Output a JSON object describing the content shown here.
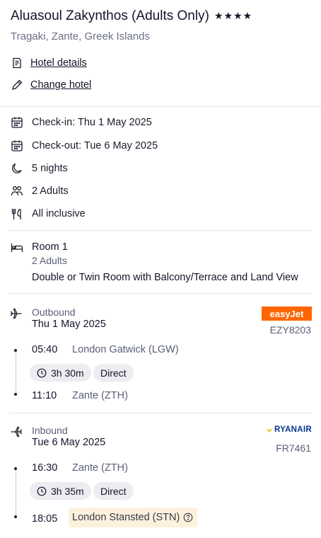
{
  "hotel": {
    "name": "Aluasoul Zakynthos (Adults Only)",
    "stars": "★★★★",
    "location": "Tragaki, Zante, Greek Islands",
    "details_link": "Hotel details",
    "change_link": "Change hotel"
  },
  "stay": {
    "checkin": "Check-in: Thu 1 May 2025",
    "checkout": "Check-out: Tue 6 May 2025",
    "nights": "5 nights",
    "guests": "2 Adults",
    "board": "All inclusive"
  },
  "room": {
    "title": "Room 1",
    "adults": "2 Adults",
    "description": "Double or Twin Room with Balcony/Terrace and Land View"
  },
  "outbound": {
    "label": "Outbound",
    "date": "Thu 1 May 2025",
    "airline": "easyJet",
    "flight_no": "EZY8203",
    "depart_time": "05:40",
    "depart_airport": "London Gatwick (LGW)",
    "duration": "3h 30m",
    "stops": "Direct",
    "arrive_time": "11:10",
    "arrive_airport": "Zante (ZTH)"
  },
  "inbound": {
    "label": "Inbound",
    "date": "Tue 6 May 2025",
    "airline": "RYANAIR",
    "flight_no": "FR7461",
    "depart_time": "16:30",
    "depart_airport": "Zante (ZTH)",
    "duration": "3h 35m",
    "stops": "Direct",
    "arrive_time": "18:05",
    "arrive_airport": "London Stansted (STN)"
  },
  "colors": {
    "easyjet_brand": "#ff6600",
    "ryanair_brand": "#073590",
    "warning_highlight": "#fdf1de",
    "chip_bg": "#ececf1"
  }
}
